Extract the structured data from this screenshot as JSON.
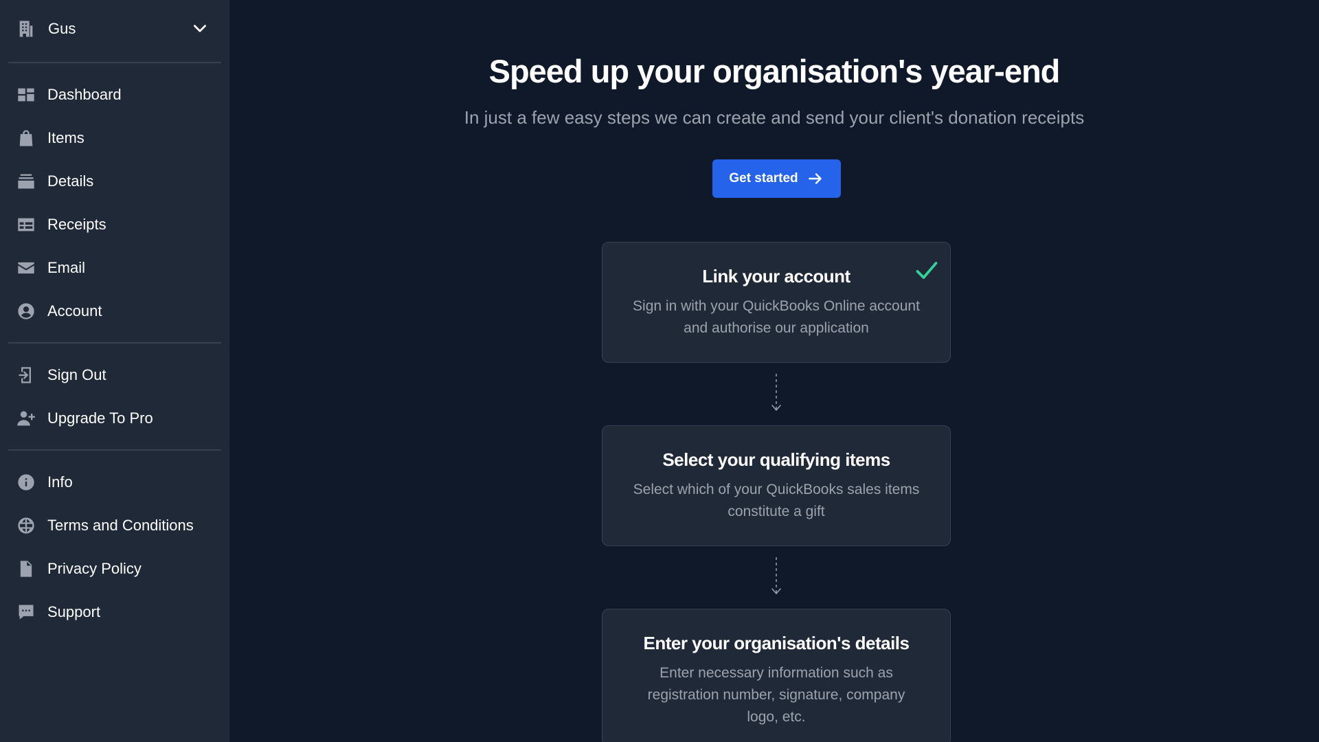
{
  "sidebar": {
    "org_name": "Gus",
    "groups": [
      [
        {
          "label": "Dashboard",
          "icon": "dashboard-icon"
        },
        {
          "label": "Items",
          "icon": "bag-icon"
        },
        {
          "label": "Details",
          "icon": "stack-icon"
        },
        {
          "label": "Receipts",
          "icon": "table-icon"
        },
        {
          "label": "Email",
          "icon": "mail-icon"
        },
        {
          "label": "Account",
          "icon": "user-circle-icon"
        }
      ],
      [
        {
          "label": "Sign Out",
          "icon": "sign-out-icon"
        },
        {
          "label": "Upgrade To Pro",
          "icon": "user-plus-icon"
        }
      ],
      [
        {
          "label": "Info",
          "icon": "info-icon"
        },
        {
          "label": "Terms and Conditions",
          "icon": "globe-icon"
        },
        {
          "label": "Privacy Policy",
          "icon": "document-icon"
        },
        {
          "label": "Support",
          "icon": "chat-icon"
        }
      ]
    ]
  },
  "main": {
    "title": "Speed up your organisation's year-end",
    "subtitle": "In just a few easy steps we can create and send your client's donation receipts",
    "cta_label": "Get started",
    "steps": [
      {
        "title": "Link your account",
        "description": "Sign in with your QuickBooks Online account and authorise our application",
        "completed": true
      },
      {
        "title": "Select your qualifying items",
        "description": "Select which of your QuickBooks sales items constitute a gift",
        "completed": false
      },
      {
        "title": "Enter your organisation's details",
        "description": "Enter necessary information such as registration number, signature, company logo, etc.",
        "completed": false
      }
    ]
  },
  "colors": {
    "background": "#0f1929",
    "sidebar": "#1f2937",
    "accent": "#2563eb",
    "check": "#34d399"
  }
}
